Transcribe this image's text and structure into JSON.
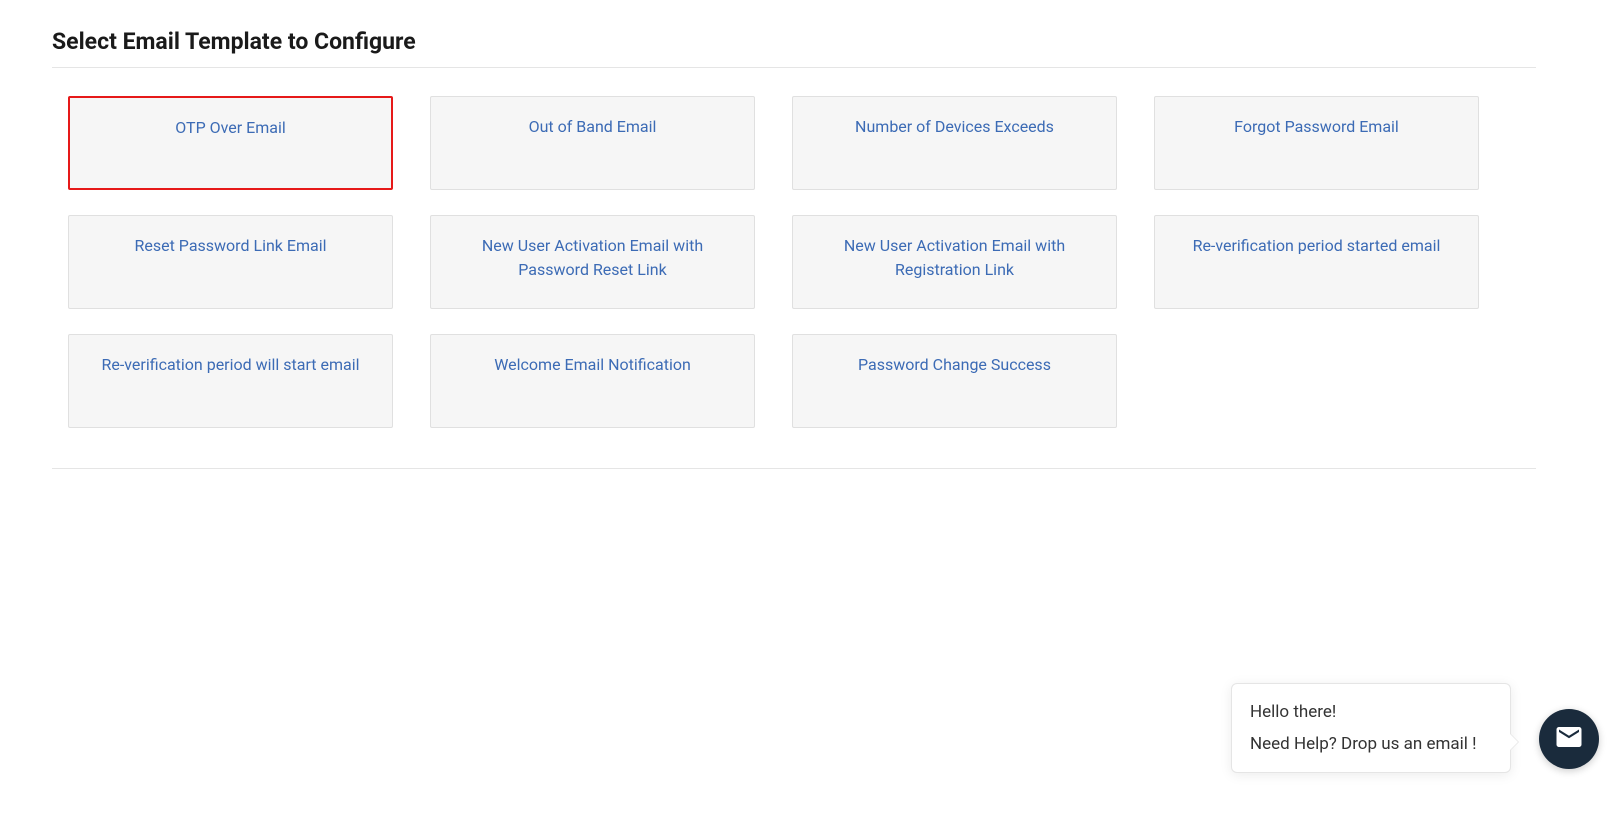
{
  "page": {
    "title": "Select Email Template to Configure"
  },
  "templates": [
    {
      "label": "OTP Over Email",
      "selected": true
    },
    {
      "label": "Out of Band Email",
      "selected": false
    },
    {
      "label": "Number of Devices Exceeds",
      "selected": false
    },
    {
      "label": "Forgot Password Email",
      "selected": false
    },
    {
      "label": "Reset Password Link Email",
      "selected": false
    },
    {
      "label": "New User Activation Email with Password Reset Link",
      "selected": false
    },
    {
      "label": "New User Activation Email with Registration Link",
      "selected": false
    },
    {
      "label": "Re-verification period started email",
      "selected": false
    },
    {
      "label": "Re-verification period will start email",
      "selected": false
    },
    {
      "label": "Welcome Email Notification",
      "selected": false
    },
    {
      "label": "Password Change Success",
      "selected": false
    }
  ],
  "chat": {
    "greeting": "Hello there!",
    "help_text": "Need Help? Drop us an email !"
  }
}
